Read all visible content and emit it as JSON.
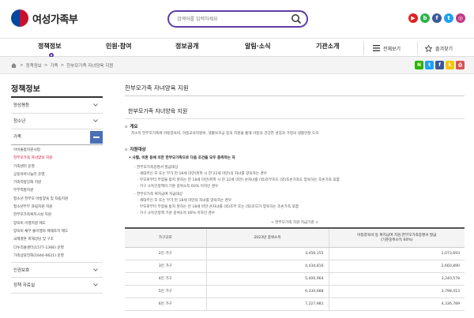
{
  "header": {
    "logo_text": "여성가족부",
    "search_placeholder": "검색어를 입력하세요",
    "social": [
      {
        "name": "youtube-icon",
        "glyph": "▶",
        "color": "#e02020"
      },
      {
        "name": "blog-icon",
        "glyph": "b",
        "color": "#2bb24c"
      },
      {
        "name": "facebook-icon",
        "glyph": "f",
        "color": "#3b5998"
      },
      {
        "name": "twitter-icon",
        "glyph": "t",
        "color": "#1da1f2"
      },
      {
        "name": "instagram-icon",
        "glyph": "◎",
        "color": "#c13584"
      }
    ]
  },
  "gnb": {
    "items": [
      "정책정보",
      "민원·참여",
      "정보공개",
      "알림·소식",
      "기관소개"
    ],
    "all_menu": "전체보기",
    "favorites": "즐겨찾기"
  },
  "breadcrumb": [
    "정책정보",
    "가족",
    "한부모가족 자녀양육 지원"
  ],
  "quick_icons": [
    {
      "name": "naver-blog-icon",
      "glyph": "N",
      "color": "#2db400"
    },
    {
      "name": "twitter-share-icon",
      "glyph": "t",
      "color": "#1da1f2"
    },
    {
      "name": "facebook-share-icon",
      "glyph": "f",
      "color": "#3b5998"
    },
    {
      "name": "kakao-share-icon",
      "glyph": "k",
      "color": "#f7c600"
    },
    {
      "name": "print-icon",
      "glyph": "⎙",
      "color": "#d9534f"
    }
  ],
  "sidebar": {
    "title": "정책정보",
    "menu": [
      {
        "label": "양성평등"
      },
      {
        "label": "청소년"
      },
      {
        "label": "가족"
      }
    ],
    "sub_items": [
      "아이돌봄지원사업",
      "한부모가족 자녀양육 지원",
      "가족센터 운영",
      "공동육아나눔터 운영",
      "가족역량강화 지원",
      "부부역할지원",
      "청소년 한부모 아동양육 및 자립지원",
      "청소년부부 자립지원 지원",
      "한부모가족복지시설 지원",
      "양육비 이행지원 제도",
      "양육비 채무 불이행자 제재조치 제도",
      "국제결혼 피해상담 및 구조",
      "다누리콜센터(1577-1366) 운영",
      "가족상담전화(1644-6621) 운영"
    ],
    "bottom_menu": [
      {
        "label": "인권보호"
      },
      {
        "label": "정책 자료실"
      }
    ]
  },
  "content": {
    "page_title": "한부모가족 자녀양육 지원",
    "section_title": "한부모가족 자녀양육 지원",
    "overview_heading": "개요",
    "overview_text": "저소득 한부모가족에 아동양육비, 아동교육지원비, 생활보조금 등의 지원을 통해 아동의 건강한 성장과 가정의 생활안정 도모",
    "target_heading": "지원대상",
    "target_intro": "• 사별, 이혼 등에 의한 한부모가족으로 다음 조건을 모두 충족하는 자",
    "lines": [
      "- 한부모가족증명서 발급대상",
      "· 세대주인 모 또는 부가 만 18세 미만(취학 시 만 22세 미만)의 자녀를 양육하는 경우",
      "· 부모로부터 부양을 받지 못하는 만 18세 미만(취학 시 만 22세 미만) 손자녀를 (외)조부모도 (외)조손가족도 양육하는 조손가족 포함",
      "· 가구 소득인정액이 기준 중위소득 60% 이하인 경우",
      "- 한부모가족 복지급여 지급대상",
      "· 세대주인 모 또는 부가 만 18세 미만의 자녀를 양육하는 경우",
      "· 부모로부터 부양을 받지 못하는 만 18세 미만 손자녀를 (외)조부 또는 (외)조모가 양육하는 조손가족 포함",
      "· 가구 소득인정액 기준 중위소득 60% 이하인 경우"
    ],
    "table_caption": "< 한부모가족 지원 지급기준 >",
    "table": {
      "headers": [
        "가구규모",
        "2023년 중위소득",
        "아동양육비 등 복지급여 지원,한부모가족증명서 발급\n(기준중위소득 60%)"
      ],
      "rows": [
        [
          "2인 가구",
          "3,456,155",
          "2,073,693"
        ],
        [
          "3인 가구",
          "4,434,816",
          "2,660,890"
        ],
        [
          "4인 가구",
          "5,400,964",
          "3,240,578"
        ],
        [
          "5인 가구",
          "6,330,688",
          "3,798,413"
        ],
        [
          "6인 가구",
          "7,227,981",
          "4,336,789"
        ]
      ]
    }
  }
}
